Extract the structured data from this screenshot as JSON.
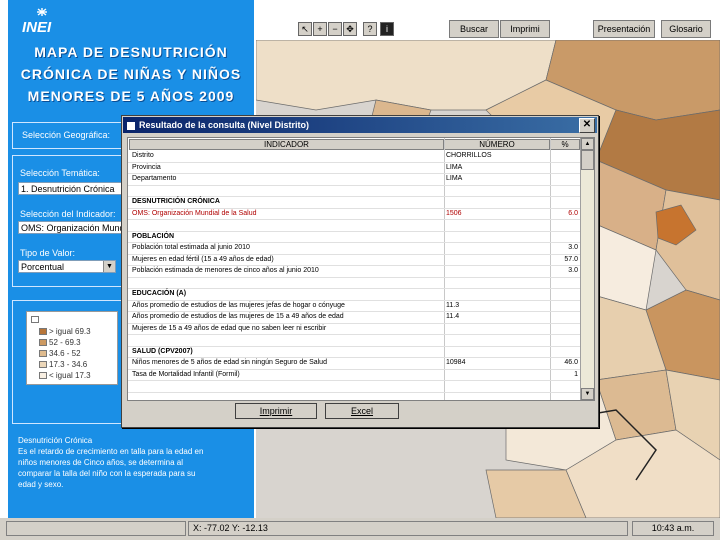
{
  "logo": "INEI",
  "titles": [
    "MAPA DE DESNUTRICIÓN",
    "CRÓNICA DE NIÑAS Y NIÑOS",
    "MENORES DE 5 AÑOS 2009"
  ],
  "labels": {
    "geo": "Selección Geográfica:",
    "tema": "Selección Temática:",
    "indicador": "Selección del Indicador:",
    "tipo": "Tipo de Valor:"
  },
  "combos": {
    "tema": "1. Desnutrición Crónica",
    "indicador": "OMS: Organización Mundial",
    "tipo": "Porcentual"
  },
  "legend": {
    "header": "",
    "items": [
      {
        "label": "> igual 69.3",
        "color": "#b8763a"
      },
      {
        "label": "52 - 69.3",
        "color": "#cd9a62"
      },
      {
        "label": "34.6 - 52",
        "color": "#dfbb8e"
      },
      {
        "label": "17.3 - 34.6",
        "color": "#ecd7b9"
      },
      {
        "label": "< igual 17.3",
        "color": "#f8efe2"
      }
    ]
  },
  "description": [
    "Desnutrición Crónica",
    "Es el retardo de crecimiento en talla para la edad en",
    "niños menores de Cinco años, se determina al",
    "comparar la talla del niño con la esperada para su",
    "edad y sexo."
  ],
  "toolbar": {
    "buscar": "Buscar",
    "imprimir": "Imprimi",
    "presentacion": "Presentación",
    "glosario": "Glosario",
    "icons": [
      "pointer-icon",
      "zoom-in-icon",
      "zoom-out-icon",
      "pan-icon",
      "identify-icon",
      "info-icon"
    ]
  },
  "status": {
    "coords": "X: -77.02   Y: -12.13",
    "time": "10:43 a.m."
  },
  "dialog": {
    "title": "Resultado de la consulta (Nivel Distrito)",
    "headers": [
      "INDICADOR",
      "NÚMERO",
      "%"
    ],
    "rows": [
      {
        "kind": "row",
        "ind": "Distrito",
        "num": "CHORRILLOS",
        "pct": ""
      },
      {
        "kind": "row",
        "ind": "Provincia",
        "num": "LIMA",
        "pct": ""
      },
      {
        "kind": "row",
        "ind": "Departamento",
        "num": "LIMA",
        "pct": ""
      },
      {
        "kind": "blank",
        "ind": "",
        "num": "",
        "pct": ""
      },
      {
        "kind": "sec",
        "ind": "DESNUTRICIÓN CRÓNICA",
        "num": "",
        "pct": ""
      },
      {
        "kind": "red",
        "ind": "OMS: Organización Mundial de la Salud",
        "num": "1506",
        "pct": "6.0"
      },
      {
        "kind": "blank",
        "ind": "",
        "num": "",
        "pct": ""
      },
      {
        "kind": "sec",
        "ind": "POBLACIÓN",
        "num": "",
        "pct": ""
      },
      {
        "kind": "row",
        "ind": "Población total estimada al junio 2010",
        "num": "",
        "pct": "3.0"
      },
      {
        "kind": "row",
        "ind": "Mujeres en edad fértil (15 a 49 años de edad)",
        "num": "",
        "pct": "57.0"
      },
      {
        "kind": "row",
        "ind": "Población estimada de menores de cinco años al junio 2010",
        "num": "",
        "pct": "3.0"
      },
      {
        "kind": "blank",
        "ind": "",
        "num": "",
        "pct": ""
      },
      {
        "kind": "sec",
        "ind": "EDUCACIÓN  (A)",
        "num": "",
        "pct": ""
      },
      {
        "kind": "row",
        "ind": "Años promedio de estudios de las mujeres jefas de hogar o cónyuge",
        "num": "11.3",
        "pct": ""
      },
      {
        "kind": "row",
        "ind": "Años promedio de estudios de las mujeres de 15 a 49 años de edad",
        "num": "11.4",
        "pct": ""
      },
      {
        "kind": "row",
        "ind": "Mujeres de 15 a 49 años de edad que no saben leer ni escribir",
        "num": "",
        "pct": ""
      },
      {
        "kind": "blank",
        "ind": "",
        "num": "",
        "pct": ""
      },
      {
        "kind": "sec",
        "ind": "SALUD  (CPV2007)",
        "num": "",
        "pct": ""
      },
      {
        "kind": "row",
        "ind": "Niños menores de 5 años de edad sin ningún Seguro de Salud",
        "num": "10984",
        "pct": "46.0"
      },
      {
        "kind": "row",
        "ind": "Tasa de Mortalidad Infantil (Formil)",
        "num": "",
        "pct": "1"
      },
      {
        "kind": "row",
        "ind": "",
        "num": "",
        "pct": ""
      }
    ],
    "buttons": {
      "imprimir": "Imprimir",
      "excel": "Excel"
    }
  }
}
